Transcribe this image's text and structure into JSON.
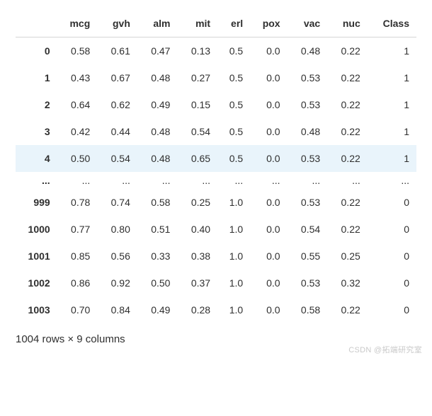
{
  "chart_data": {
    "type": "table",
    "title": "",
    "columns": [
      "mcg",
      "gvh",
      "alm",
      "mit",
      "erl",
      "pox",
      "vac",
      "nuc",
      "Class"
    ],
    "index_shown": [
      "0",
      "1",
      "2",
      "3",
      "4",
      "...",
      "999",
      "1000",
      "1001",
      "1002",
      "1003"
    ],
    "rows_shown": {
      "0": {
        "mcg": 0.58,
        "gvh": 0.61,
        "alm": 0.47,
        "mit": 0.13,
        "erl": 0.5,
        "pox": 0.0,
        "vac": 0.48,
        "nuc": 0.22,
        "Class": 1
      },
      "1": {
        "mcg": 0.43,
        "gvh": 0.67,
        "alm": 0.48,
        "mit": 0.27,
        "erl": 0.5,
        "pox": 0.0,
        "vac": 0.53,
        "nuc": 0.22,
        "Class": 1
      },
      "2": {
        "mcg": 0.64,
        "gvh": 0.62,
        "alm": 0.49,
        "mit": 0.15,
        "erl": 0.5,
        "pox": 0.0,
        "vac": 0.53,
        "nuc": 0.22,
        "Class": 1
      },
      "3": {
        "mcg": 0.42,
        "gvh": 0.44,
        "alm": 0.48,
        "mit": 0.54,
        "erl": 0.5,
        "pox": 0.0,
        "vac": 0.48,
        "nuc": 0.22,
        "Class": 1
      },
      "4": {
        "mcg": 0.5,
        "gvh": 0.54,
        "alm": 0.48,
        "mit": 0.65,
        "erl": 0.5,
        "pox": 0.0,
        "vac": 0.53,
        "nuc": 0.22,
        "Class": 1
      },
      "999": {
        "mcg": 0.78,
        "gvh": 0.74,
        "alm": 0.58,
        "mit": 0.25,
        "erl": 1.0,
        "pox": 0.0,
        "vac": 0.53,
        "nuc": 0.22,
        "Class": 0
      },
      "1000": {
        "mcg": 0.77,
        "gvh": 0.8,
        "alm": 0.51,
        "mit": 0.4,
        "erl": 1.0,
        "pox": 0.0,
        "vac": 0.54,
        "nuc": 0.22,
        "Class": 0
      },
      "1001": {
        "mcg": 0.85,
        "gvh": 0.56,
        "alm": 0.33,
        "mit": 0.38,
        "erl": 1.0,
        "pox": 0.0,
        "vac": 0.55,
        "nuc": 0.25,
        "Class": 0
      },
      "1002": {
        "mcg": 0.86,
        "gvh": 0.92,
        "alm": 0.5,
        "mit": 0.37,
        "erl": 1.0,
        "pox": 0.0,
        "vac": 0.53,
        "nuc": 0.32,
        "Class": 0
      },
      "1003": {
        "mcg": 0.7,
        "gvh": 0.84,
        "alm": 0.49,
        "mit": 0.28,
        "erl": 1.0,
        "pox": 0.0,
        "vac": 0.58,
        "nuc": 0.22,
        "Class": 0
      }
    },
    "n_rows": 1004,
    "n_cols": 9
  },
  "header": {
    "corner": "",
    "mcg": "mcg",
    "gvh": "gvh",
    "alm": "alm",
    "mit": "mit",
    "erl": "erl",
    "pox": "pox",
    "vac": "vac",
    "nuc": "nuc",
    "Class": "Class"
  },
  "rows": [
    {
      "highlight": false,
      "idx": "0",
      "mcg": "0.58",
      "gvh": "0.61",
      "alm": "0.47",
      "mit": "0.13",
      "erl": "0.5",
      "pox": "0.0",
      "vac": "0.48",
      "nuc": "0.22",
      "Class": "1"
    },
    {
      "highlight": false,
      "idx": "1",
      "mcg": "0.43",
      "gvh": "0.67",
      "alm": "0.48",
      "mit": "0.27",
      "erl": "0.5",
      "pox": "0.0",
      "vac": "0.53",
      "nuc": "0.22",
      "Class": "1"
    },
    {
      "highlight": false,
      "idx": "2",
      "mcg": "0.64",
      "gvh": "0.62",
      "alm": "0.49",
      "mit": "0.15",
      "erl": "0.5",
      "pox": "0.0",
      "vac": "0.53",
      "nuc": "0.22",
      "Class": "1"
    },
    {
      "highlight": false,
      "idx": "3",
      "mcg": "0.42",
      "gvh": "0.44",
      "alm": "0.48",
      "mit": "0.54",
      "erl": "0.5",
      "pox": "0.0",
      "vac": "0.48",
      "nuc": "0.22",
      "Class": "1"
    },
    {
      "highlight": true,
      "idx": "4",
      "mcg": "0.50",
      "gvh": "0.54",
      "alm": "0.48",
      "mit": "0.65",
      "erl": "0.5",
      "pox": "0.0",
      "vac": "0.53",
      "nuc": "0.22",
      "Class": "1"
    },
    {
      "highlight": false,
      "ellipsis": true,
      "idx": "...",
      "mcg": "...",
      "gvh": "...",
      "alm": "...",
      "mit": "...",
      "erl": "...",
      "pox": "...",
      "vac": "...",
      "nuc": "...",
      "Class": "..."
    },
    {
      "highlight": false,
      "idx": "999",
      "mcg": "0.78",
      "gvh": "0.74",
      "alm": "0.58",
      "mit": "0.25",
      "erl": "1.0",
      "pox": "0.0",
      "vac": "0.53",
      "nuc": "0.22",
      "Class": "0"
    },
    {
      "highlight": false,
      "idx": "1000",
      "mcg": "0.77",
      "gvh": "0.80",
      "alm": "0.51",
      "mit": "0.40",
      "erl": "1.0",
      "pox": "0.0",
      "vac": "0.54",
      "nuc": "0.22",
      "Class": "0"
    },
    {
      "highlight": false,
      "idx": "1001",
      "mcg": "0.85",
      "gvh": "0.56",
      "alm": "0.33",
      "mit": "0.38",
      "erl": "1.0",
      "pox": "0.0",
      "vac": "0.55",
      "nuc": "0.25",
      "Class": "0"
    },
    {
      "highlight": false,
      "idx": "1002",
      "mcg": "0.86",
      "gvh": "0.92",
      "alm": "0.50",
      "mit": "0.37",
      "erl": "1.0",
      "pox": "0.0",
      "vac": "0.53",
      "nuc": "0.32",
      "Class": "0"
    },
    {
      "highlight": false,
      "idx": "1003",
      "mcg": "0.70",
      "gvh": "0.84",
      "alm": "0.49",
      "mit": "0.28",
      "erl": "1.0",
      "pox": "0.0",
      "vac": "0.58",
      "nuc": "0.22",
      "Class": "0"
    }
  ],
  "summary": "1004 rows × 9 columns",
  "watermark": "CSDN @拓端研究室"
}
